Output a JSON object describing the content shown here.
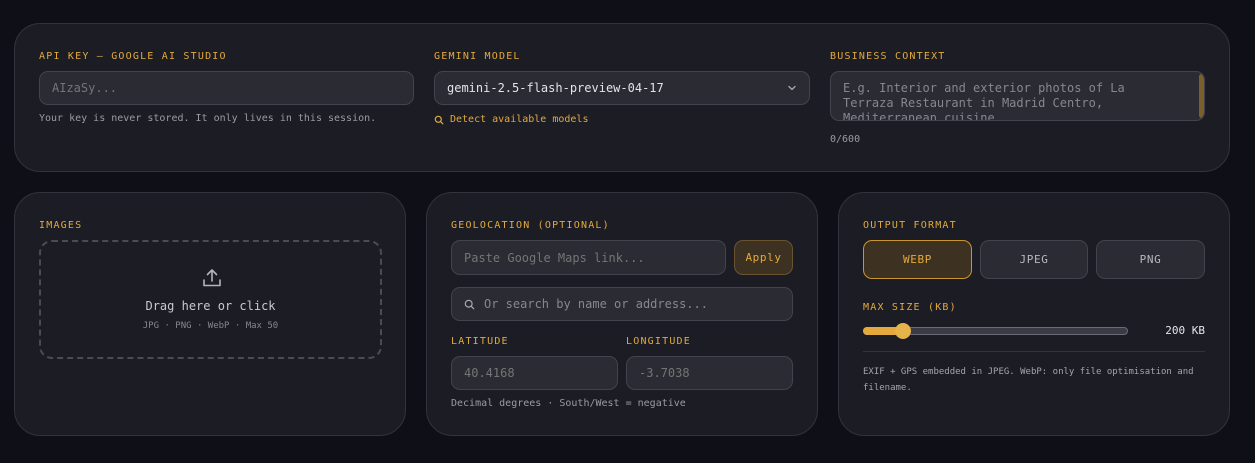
{
  "api": {
    "label": "API KEY — GOOGLE AI STUDIO",
    "placeholder": "AIzaSy...",
    "hint": "Your key is never stored. It only lives in this session."
  },
  "model": {
    "label": "GEMINI MODEL",
    "selected": "gemini-2.5-flash-preview-04-17",
    "detect_link": "Detect available models"
  },
  "context": {
    "label": "BUSINESS CONTEXT",
    "placeholder": "E.g. Interior and exterior photos of La Terraza Restaurant in Madrid Centro, Mediterranean cuisine",
    "counter": "0/600"
  },
  "images": {
    "label": "IMAGES",
    "drop_text": "Drag here or click",
    "formats": "JPG · PNG · WebP · Max 50"
  },
  "geo": {
    "label": "GEOLOCATION (OPTIONAL)",
    "maps_placeholder": "Paste Google Maps link...",
    "apply_label": "Apply",
    "search_placeholder": "Or search by name or address...",
    "lat_label": "LATITUDE",
    "lat_placeholder": "40.4168",
    "lon_label": "LONGITUDE",
    "lon_placeholder": "-3.7038",
    "hint": "Decimal degrees · South/West = negative"
  },
  "output": {
    "label": "OUTPUT FORMAT",
    "formats": [
      "WEBP",
      "JPEG",
      "PNG"
    ],
    "selected_format": "WEBP",
    "max_size_label": "MAX SIZE (KB)",
    "max_size_value": "200 KB",
    "slider_fraction": 0.12,
    "note": "EXIF + GPS embedded in JPEG. WebP: only file optimisation and filename."
  },
  "colors": {
    "accent": "#e3a93c",
    "background": "#0f1017",
    "card": "#1c1d24"
  }
}
